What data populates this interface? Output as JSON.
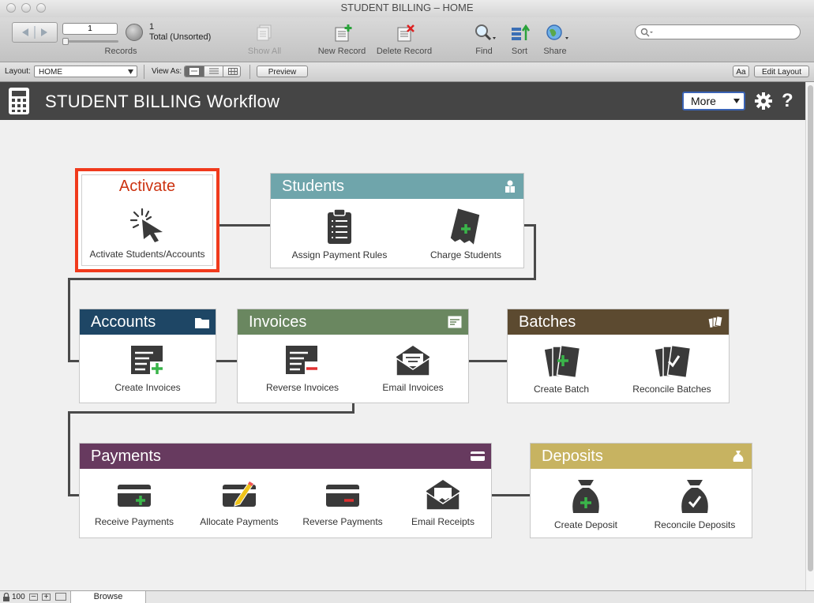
{
  "window": {
    "title": "STUDENT BILLING – HOME"
  },
  "toolbar": {
    "record_number": "1",
    "records_label": "Records",
    "found_count": "1",
    "total_label": "Total (Unsorted)",
    "show_all": "Show All",
    "new_record": "New Record",
    "delete_record": "Delete Record",
    "find": "Find",
    "sort": "Sort",
    "share": "Share",
    "search_placeholder": ""
  },
  "layoutbar": {
    "layout_label": "Layout:",
    "layout_value": "HOME",
    "view_as_label": "View As:",
    "preview": "Preview",
    "aa": "Aa",
    "edit_layout": "Edit Layout"
  },
  "header": {
    "title": "STUDENT BILLING Workflow",
    "more": "More"
  },
  "cards": {
    "activate": {
      "title": "Activate",
      "items": [
        "Activate Students/Accounts"
      ],
      "color": "#cc3311"
    },
    "students": {
      "title": "Students",
      "items": [
        "Assign Payment Rules",
        "Charge Students"
      ],
      "color": "#6fa5ab"
    },
    "accounts": {
      "title": "Accounts",
      "items": [
        "Create Invoices"
      ],
      "color": "#1e4665"
    },
    "invoices": {
      "title": "Invoices",
      "items": [
        "Reverse Invoices",
        "Email Invoices"
      ],
      "color": "#6a8760"
    },
    "batches": {
      "title": "Batches",
      "items": [
        "Create Batch",
        "Reconcile Batches"
      ],
      "color": "#5c4a30"
    },
    "payments": {
      "title": "Payments",
      "items": [
        "Receive Payments",
        "Allocate Payments",
        "Reverse Payments",
        "Email Receipts"
      ],
      "color": "#673a5f"
    },
    "deposits": {
      "title": "Deposits",
      "items": [
        "Create Deposit",
        "Reconcile Deposits"
      ],
      "color": "#c7b361"
    }
  },
  "statusbar": {
    "zoom": "100",
    "mode": "Browse"
  }
}
